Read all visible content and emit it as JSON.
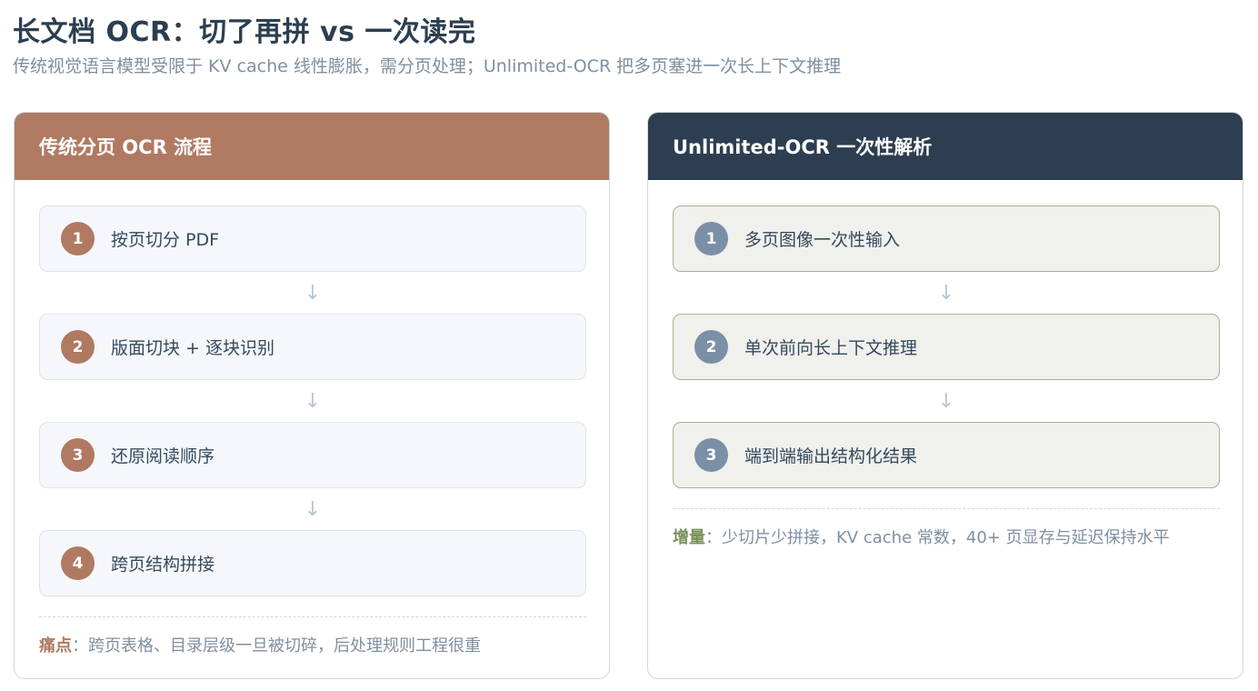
{
  "title": "长文档 OCR：切了再拼 vs 一次读完",
  "subtitle": "传统视觉语言模型受限于 KV cache 线性膨胀，需分页处理；Unlimited-OCR 把多页塞进一次长上下文推理",
  "left": {
    "header": "传统分页 OCR 流程",
    "steps": [
      {
        "num": "1",
        "label": "按页切分 PDF"
      },
      {
        "num": "2",
        "label": "版面切块 + 逐块识别"
      },
      {
        "num": "3",
        "label": "还原阅读顺序"
      },
      {
        "num": "4",
        "label": "跨页结构拼接"
      }
    ],
    "arrow": "↓",
    "note_key": "痛点",
    "note_sep": "：",
    "note_text": "跨页表格、目录层级一旦被切碎，后处理规则工程很重"
  },
  "right": {
    "header": "Unlimited-OCR 一次性解析",
    "steps": [
      {
        "num": "1",
        "label": "多页图像一次性输入"
      },
      {
        "num": "2",
        "label": "单次前向长上下文推理"
      },
      {
        "num": "3",
        "label": "端到端输出结构化结果"
      }
    ],
    "arrow": "↓",
    "note_key": "增量",
    "note_sep": "：",
    "note_text": "少切片少拼接，KV cache 常数，40+ 页显存与延迟保持水平"
  },
  "colors": {
    "left_accent": "#b07a62",
    "right_header": "#2d3e50",
    "right_badge": "#7b90a6",
    "right_note_key": "#7b8f5a"
  }
}
